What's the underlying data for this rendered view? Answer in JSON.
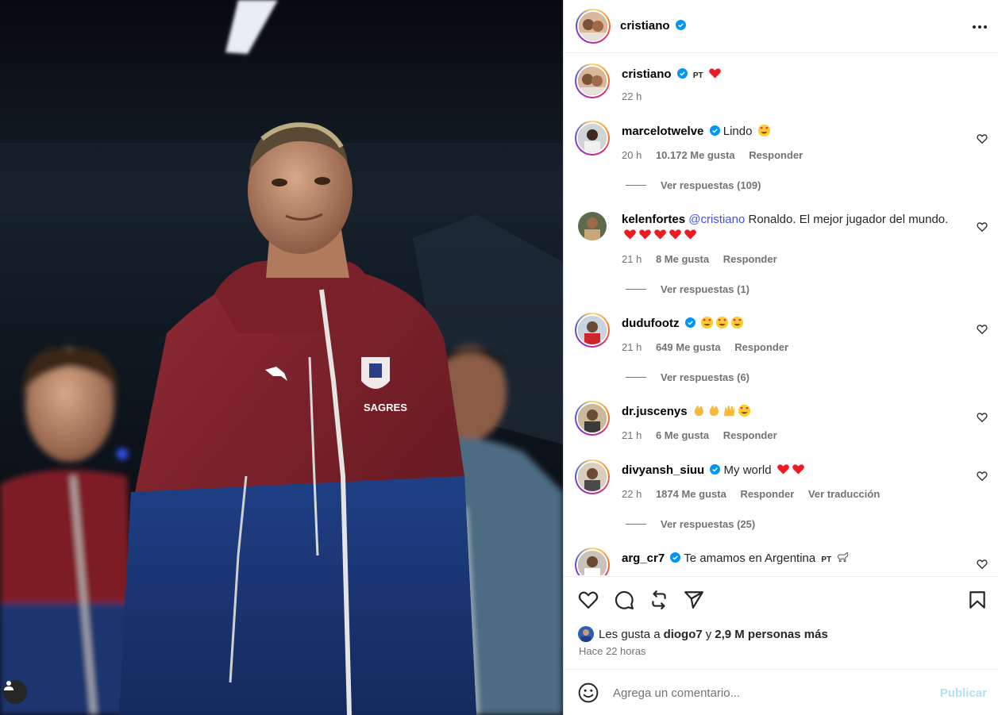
{
  "post": {
    "author": "cristiano",
    "photo_alt": "Cristiano Ronaldo walking with Portugal teammates in red and blue tracksuits"
  },
  "header": {
    "username": "cristiano",
    "more_icon": "more-horizontal-icon"
  },
  "caption": {
    "username": "cristiano",
    "flag": "PT",
    "time": "22 h"
  },
  "comments": [
    {
      "username": "marcelotwelve",
      "verified": true,
      "text": "Lindo",
      "time": "20 h",
      "likes": "10.172 Me gusta",
      "reply": "Responder",
      "replies": "Ver respuestas (109)"
    },
    {
      "username": "kelenfortes",
      "verified": false,
      "mention": "@cristiano",
      "text": " Ronaldo. El mejor jugador del mundo.",
      "time": "21 h",
      "likes": "8 Me gusta",
      "reply": "Responder",
      "replies": "Ver respuestas (1)"
    },
    {
      "username": "dudufootz",
      "verified": true,
      "text": "",
      "time": "21 h",
      "likes": "649 Me gusta",
      "reply": "Responder",
      "replies": "Ver respuestas (6)"
    },
    {
      "username": "dr.juscenys",
      "verified": false,
      "text": "",
      "time": "21 h",
      "likes": "6 Me gusta",
      "reply": "Responder"
    },
    {
      "username": "divyansh_siuu",
      "verified": true,
      "text": "My world",
      "time": "22 h",
      "likes": "1874 Me gusta",
      "reply": "Responder",
      "translate": "Ver traducción",
      "replies": "Ver respuestas (25)"
    },
    {
      "username": "arg_cr7",
      "verified": true,
      "text": "Te amamos en Argentina",
      "flag": "PT"
    }
  ],
  "actions": {
    "like_icon": "heart-icon",
    "comment_icon": "comment-icon",
    "repost_icon": "repost-icon",
    "share_icon": "send-icon",
    "save_icon": "bookmark-icon"
  },
  "likes": {
    "prefix": "Les gusta a",
    "friend": "diogo7",
    "joiner": "y",
    "count": "2,9 M personas más"
  },
  "timestamp": "Hace 22 horas",
  "composer": {
    "placeholder": "Agrega un comentario...",
    "publish": "Publicar"
  },
  "colors": {
    "verified": "#0095f6",
    "heart": "#ed1c24",
    "publish_disabled": "#b2dffc",
    "mention": "#4150f7"
  }
}
